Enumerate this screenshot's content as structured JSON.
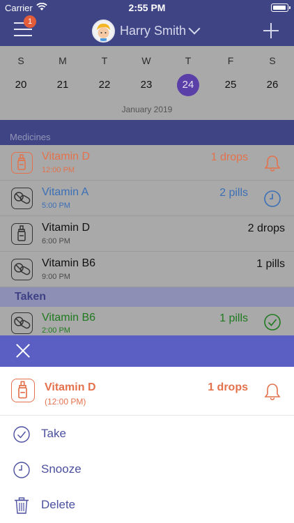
{
  "status_bar": {
    "carrier": "Carrier",
    "time": "2:55 PM"
  },
  "nav": {
    "notification_count": "1",
    "user_name": "Harry Smith"
  },
  "calendar": {
    "days": [
      {
        "dow": "S",
        "num": "20"
      },
      {
        "dow": "M",
        "num": "21"
      },
      {
        "dow": "T",
        "num": "22"
      },
      {
        "dow": "W",
        "num": "23"
      },
      {
        "dow": "T",
        "num": "24",
        "selected": true
      },
      {
        "dow": "F",
        "num": "25"
      },
      {
        "dow": "S",
        "num": "26"
      }
    ],
    "month_label": "January 2019"
  },
  "medicines": {
    "section_label": "Medicines",
    "items": [
      {
        "name": "Vitamin D",
        "time": "12:00 PM",
        "dose": "1 drops",
        "icon": "dropper-bottle-icon",
        "status_icon": "bell-icon",
        "color": "#e3724c"
      },
      {
        "name": "Vitamin A",
        "time": "5:00 PM",
        "dose": "2 pills",
        "icon": "pills-icon",
        "status_icon": "clock-icon",
        "color": "#3b6fb6"
      },
      {
        "name": "Vitamin D",
        "time": "6:00 PM",
        "dose": "2 drops",
        "icon": "dropper-bottle-icon",
        "color": "#111111"
      },
      {
        "name": "Vitamin B6",
        "time": "9:00 PM",
        "dose": "1 pills",
        "icon": "pills-icon",
        "color": "#111111"
      }
    ]
  },
  "taken": {
    "section_label": "Taken",
    "items": [
      {
        "name": "Vitamin B6",
        "time": "2:00 PM",
        "dose": "1 pills",
        "icon": "pills-icon",
        "status_icon": "checkmark-circle-icon",
        "color": "#1f7a1f"
      }
    ]
  },
  "sheet": {
    "medicine": {
      "name": "Vitamin D",
      "time": "(12:00 PM)",
      "dose": "1 drops",
      "color": "#e3724c"
    },
    "actions": [
      {
        "label": "Take",
        "icon": "checkmark-circle-icon"
      },
      {
        "label": "Snooze",
        "icon": "clock-icon"
      },
      {
        "label": "Delete",
        "icon": "trash-icon"
      }
    ]
  },
  "colors": {
    "nav": "#3f4485",
    "accent": "#5b5fc4",
    "selected_day": "#5b3fa8",
    "alert": "#e3724c"
  }
}
